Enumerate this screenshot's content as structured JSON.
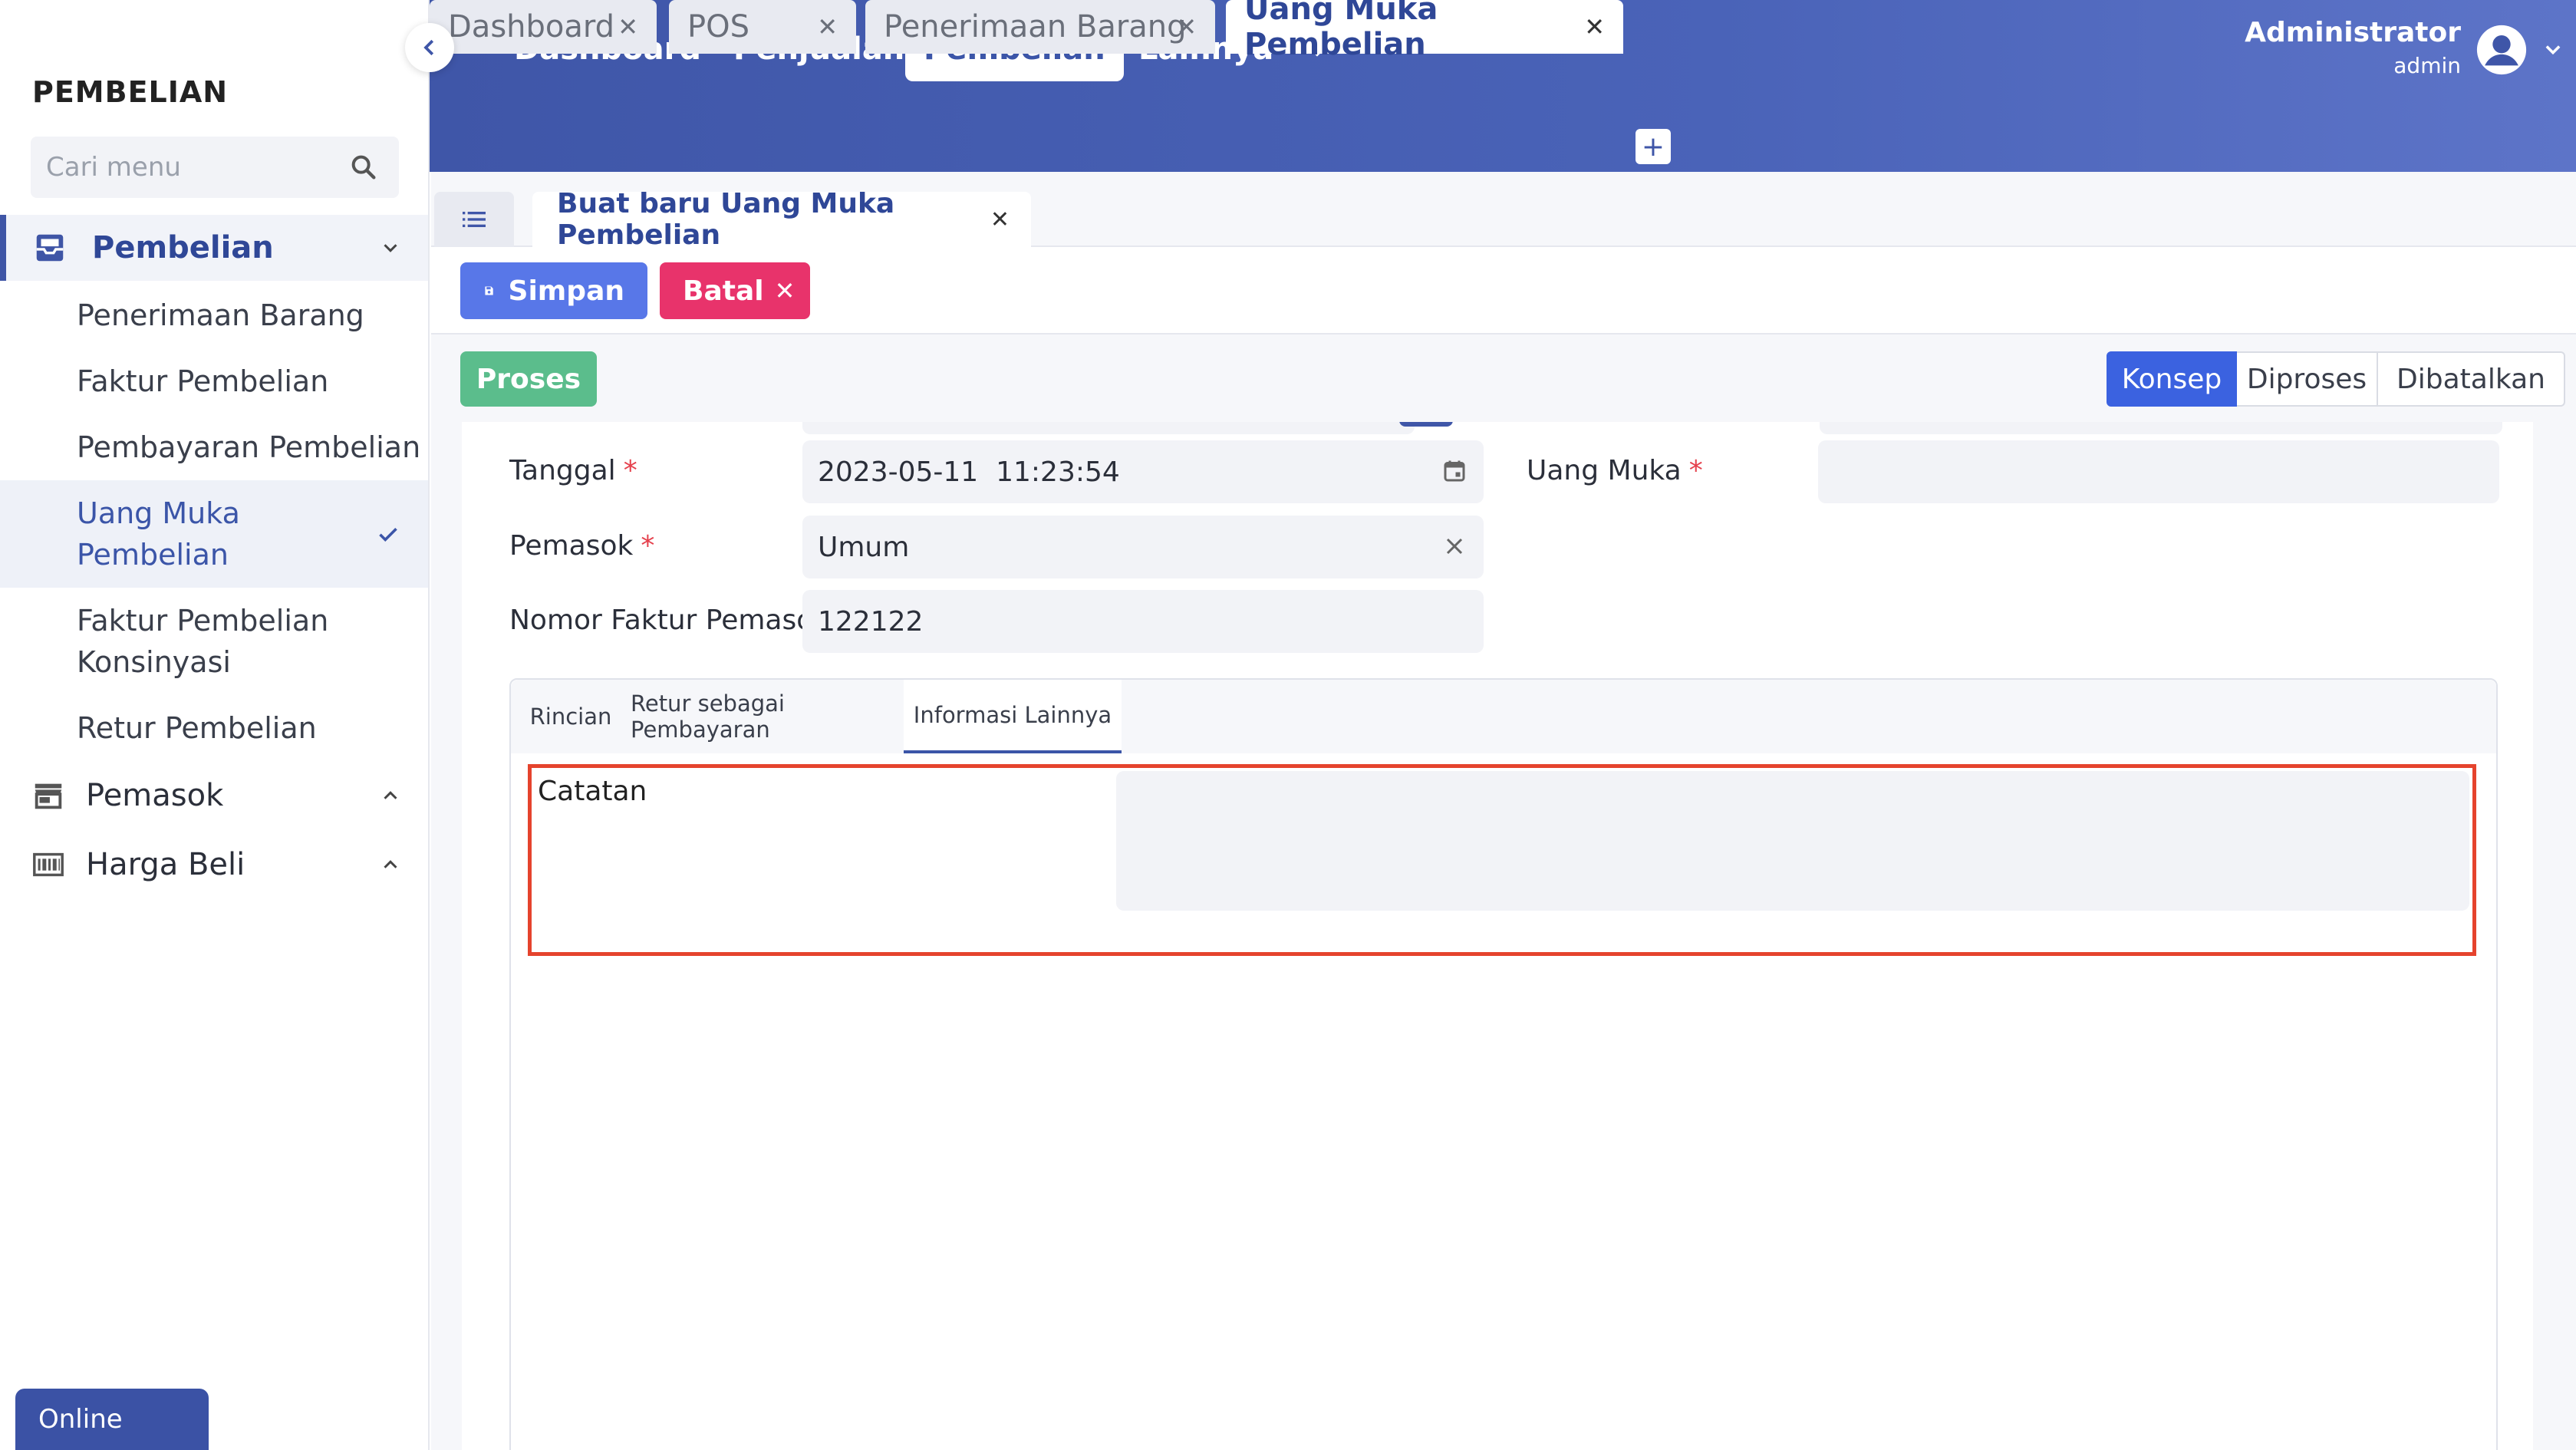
{
  "sidebar": {
    "title": "PEMBELIAN",
    "search_placeholder": "Cari menu",
    "groups": [
      {
        "label": "Pembelian",
        "icon": "inbox-tray-icon",
        "expanded": true
      },
      {
        "label": "Pemasok",
        "icon": "store-icon",
        "expanded": false
      },
      {
        "label": "Harga Beli",
        "icon": "barcode-icon",
        "expanded": false
      }
    ],
    "items": [
      {
        "label": "Penerimaan Barang"
      },
      {
        "label": "Faktur Pembelian"
      },
      {
        "label": "Pembayaran Pembelian"
      },
      {
        "label": "Uang Muka Pembelian",
        "current": true
      },
      {
        "label": "Faktur Pembelian Konsinyasi"
      },
      {
        "label": "Retur Pembelian"
      }
    ],
    "status": "Online"
  },
  "topnav": {
    "items": [
      {
        "label": "Dashboard"
      },
      {
        "label": "Penjualan"
      },
      {
        "label": "Pembelian",
        "active": true
      },
      {
        "label": "Lainnya"
      }
    ],
    "user_name": "Administrator",
    "user_role": "admin"
  },
  "tabs": [
    {
      "label": "Dashboard",
      "active": false
    },
    {
      "label": "POS",
      "active": false
    },
    {
      "label": "Penerimaan Barang",
      "active": false
    },
    {
      "label": "Uang Muka Pembelian",
      "active": true
    }
  ],
  "tab_add_label": "+",
  "doc_tab_label": "Buat baru Uang Muka Pembelian",
  "toolbar": {
    "save_label": "Simpan",
    "cancel_label": "Batal",
    "process_label": "Proses"
  },
  "statuses": [
    {
      "label": "Konsep",
      "active": true
    },
    {
      "label": "Diproses",
      "active": false
    },
    {
      "label": "Dibatalkan",
      "active": false
    }
  ],
  "form": {
    "tanggal_label": "Tanggal",
    "tanggal_value": "2023-05-11  11:23:54",
    "pemasok_label": "Pemasok",
    "pemasok_value": "Umum",
    "nomor_faktur_label": "Nomor Faktur Pemasok",
    "nomor_faktur_value": "122122",
    "uang_muka_label": "Uang Muka",
    "uang_muka_value": "",
    "required_mark": "*"
  },
  "panel": {
    "tabs": [
      {
        "label": "Rincian",
        "active": false
      },
      {
        "label": "Retur sebagai Pembayaran",
        "active": false
      },
      {
        "label": "Informasi Lainnya",
        "active": true
      }
    ],
    "catatan_label": "Catatan",
    "catatan_value": ""
  },
  "colors": {
    "brand": "#3f56a8",
    "save": "#5877e8",
    "cancel": "#e8336b",
    "process": "#5bbd8c",
    "status_active": "#3b62e0",
    "highlight": "#e5432d"
  }
}
